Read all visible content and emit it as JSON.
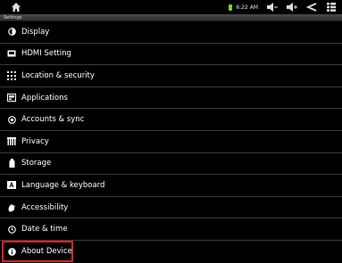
{
  "status_bar": {
    "time": "6:22 AM",
    "icons": [
      "home-icon",
      "battery-icon",
      "volume-down-icon",
      "volume-up-icon",
      "back-icon",
      "menu-icon"
    ],
    "battery_color": "#7bd32a"
  },
  "title_bar": {
    "title": "Settings"
  },
  "settings": {
    "items": [
      {
        "label": "Display",
        "icon": "display-icon"
      },
      {
        "label": "HDMI Setting",
        "icon": "hdmi-icon"
      },
      {
        "label": "Location & security",
        "icon": "location-security-icon"
      },
      {
        "label": "Applications",
        "icon": "applications-icon"
      },
      {
        "label": "Accounts & sync",
        "icon": "accounts-sync-icon"
      },
      {
        "label": "Privacy",
        "icon": "privacy-icon"
      },
      {
        "label": "Storage",
        "icon": "storage-icon"
      },
      {
        "label": "Language & keyboard",
        "icon": "language-keyboard-icon"
      },
      {
        "label": "Accessibility",
        "icon": "accessibility-icon"
      },
      {
        "label": "Date & time",
        "icon": "clock-icon"
      },
      {
        "label": "About Device",
        "icon": "info-icon"
      }
    ],
    "highlight_color": "#d1262e"
  }
}
